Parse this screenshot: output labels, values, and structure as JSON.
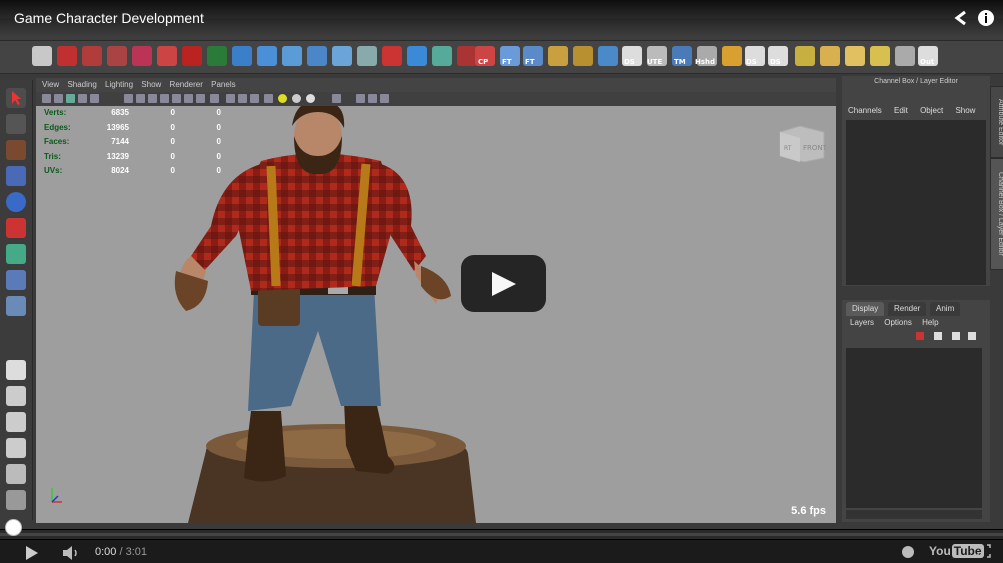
{
  "video": {
    "title": "Game Character Development",
    "current_time": "0:00",
    "duration": "3:01",
    "progress": 0.0
  },
  "viewport": {
    "menu": [
      "View",
      "Shading",
      "Lighting",
      "Show",
      "Renderer",
      "Panels"
    ],
    "hud": [
      {
        "label": "Verts:",
        "value": "6835",
        "a": "0",
        "b": "0"
      },
      {
        "label": "Edges:",
        "value": "13965",
        "a": "0",
        "b": "0"
      },
      {
        "label": "Faces:",
        "value": "7144",
        "a": "0",
        "b": "0"
      },
      {
        "label": "Tris:",
        "value": "13239",
        "a": "0",
        "b": "0"
      },
      {
        "label": "UVs:",
        "value": "8024",
        "a": "0",
        "b": "0"
      }
    ],
    "viewcube_label": "FRONT",
    "viewcube_side": "RT",
    "fps": "5.6 fps"
  },
  "channel_box": {
    "title": "Channel Box / Layer Editor",
    "menu": [
      "Channels",
      "Edit",
      "Object",
      "Show"
    ]
  },
  "layer_editor": {
    "tabs": [
      "Display",
      "Render",
      "Anim"
    ],
    "menu": [
      "Layers",
      "Options",
      "Help"
    ]
  },
  "side_tabs": [
    "Attribute Editor",
    "Channel Box / Layer Editor"
  ],
  "shelf_labels": [
    "CP",
    "FT",
    "FT",
    "DS",
    "UTE",
    "TM",
    "Hshd",
    "DS",
    "DS",
    "Out"
  ],
  "logo": {
    "you": "You",
    "tube": "Tube"
  },
  "colors": {
    "viewport_bg": "#9e9e9e",
    "hud_label": "#0b5a1a",
    "ui_dark": "#3a3a3a"
  }
}
